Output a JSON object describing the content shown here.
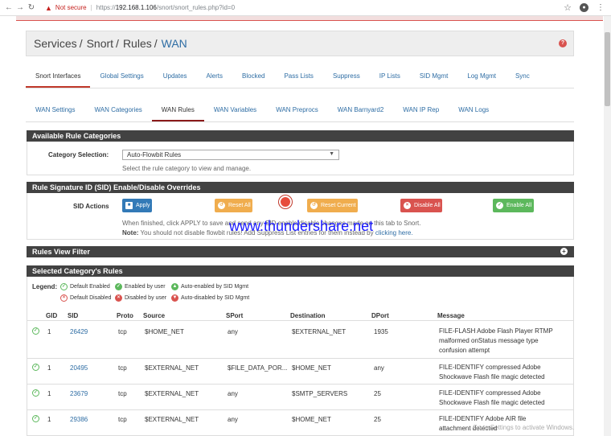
{
  "browser": {
    "security": "Not secure",
    "url_prefix": "https://",
    "url_host": "192.168.1.106",
    "url_path": "/snort/snort_rules.php?id=0"
  },
  "breadcrumb": {
    "items": [
      "Services",
      "Snort",
      "Rules"
    ],
    "active": "WAN"
  },
  "main_tabs": [
    "Snort Interfaces",
    "Global Settings",
    "Updates",
    "Alerts",
    "Blocked",
    "Pass Lists",
    "Suppress",
    "IP Lists",
    "SID Mgmt",
    "Log Mgmt",
    "Sync"
  ],
  "sub_tabs": [
    "WAN Settings",
    "WAN Categories",
    "WAN Rules",
    "WAN Variables",
    "WAN Preprocs",
    "WAN Barnyard2",
    "WAN IP Rep",
    "WAN Logs"
  ],
  "categories_panel": {
    "title": "Available Rule Categories",
    "label": "Category Selection:",
    "selected": "Auto-Flowbit Rules",
    "hint": "Select the rule category to view and manage."
  },
  "sid_panel": {
    "title": "Rule Signature ID (SID) Enable/Disable Overrides",
    "label": "SID Actions",
    "buttons": {
      "apply": "Apply",
      "reset_all": "Reset All",
      "reset_current": "Reset Current",
      "disable_all": "Disable All",
      "enable_all": "Enable All"
    },
    "note1": "When finished, click APPLY to save and send any SID enable/disable changes made on this tab to Snort.",
    "note2_label": "Note:",
    "note2": "You should not disable flowbit rules! Add Suppress List entries for them instead by",
    "note2_link": "clicking here."
  },
  "watermark": "www.thundershare.net",
  "filter_panel": {
    "title": "Rules View Filter"
  },
  "rules_panel": {
    "title": "Selected Category's Rules",
    "legend_label": "Legend:",
    "legend": [
      "Default Enabled",
      "Enabled by user",
      "Auto-enabled by SID Mgmt",
      "Default Disabled",
      "Disabled by user",
      "Auto-disabled by SID Mgmt"
    ],
    "headers": [
      "GID",
      "SID",
      "Proto",
      "Source",
      "SPort",
      "Destination",
      "DPort",
      "Message"
    ],
    "rows": [
      {
        "gid": "1",
        "sid": "26429",
        "proto": "tcp",
        "source": "$HOME_NET",
        "sport": "any",
        "dest": "$EXTERNAL_NET",
        "dport": "1935",
        "message": "FILE-FLASH Adobe Flash Player RTMP malformed onStatus message type confusion attempt"
      },
      {
        "gid": "1",
        "sid": "20495",
        "proto": "tcp",
        "source": "$EXTERNAL_NET",
        "sport": "$FILE_DATA_POR...",
        "dest": "$HOME_NET",
        "dport": "any",
        "message": "FILE-IDENTIFY compressed Adobe Shockwave Flash file magic detected"
      },
      {
        "gid": "1",
        "sid": "23679",
        "proto": "tcp",
        "source": "$EXTERNAL_NET",
        "sport": "any",
        "dest": "$SMTP_SERVERS",
        "dport": "25",
        "message": "FILE-IDENTIFY compressed Adobe Shockwave Flash file magic detected"
      },
      {
        "gid": "1",
        "sid": "29386",
        "proto": "tcp",
        "source": "$EXTERNAL_NET",
        "sport": "any",
        "dest": "$HOME_NET",
        "dport": "25",
        "message": "FILE-IDENTIFY Adobe AIR file attachment detected"
      }
    ]
  },
  "os_overlay": "Go to Settings to activate Windows."
}
